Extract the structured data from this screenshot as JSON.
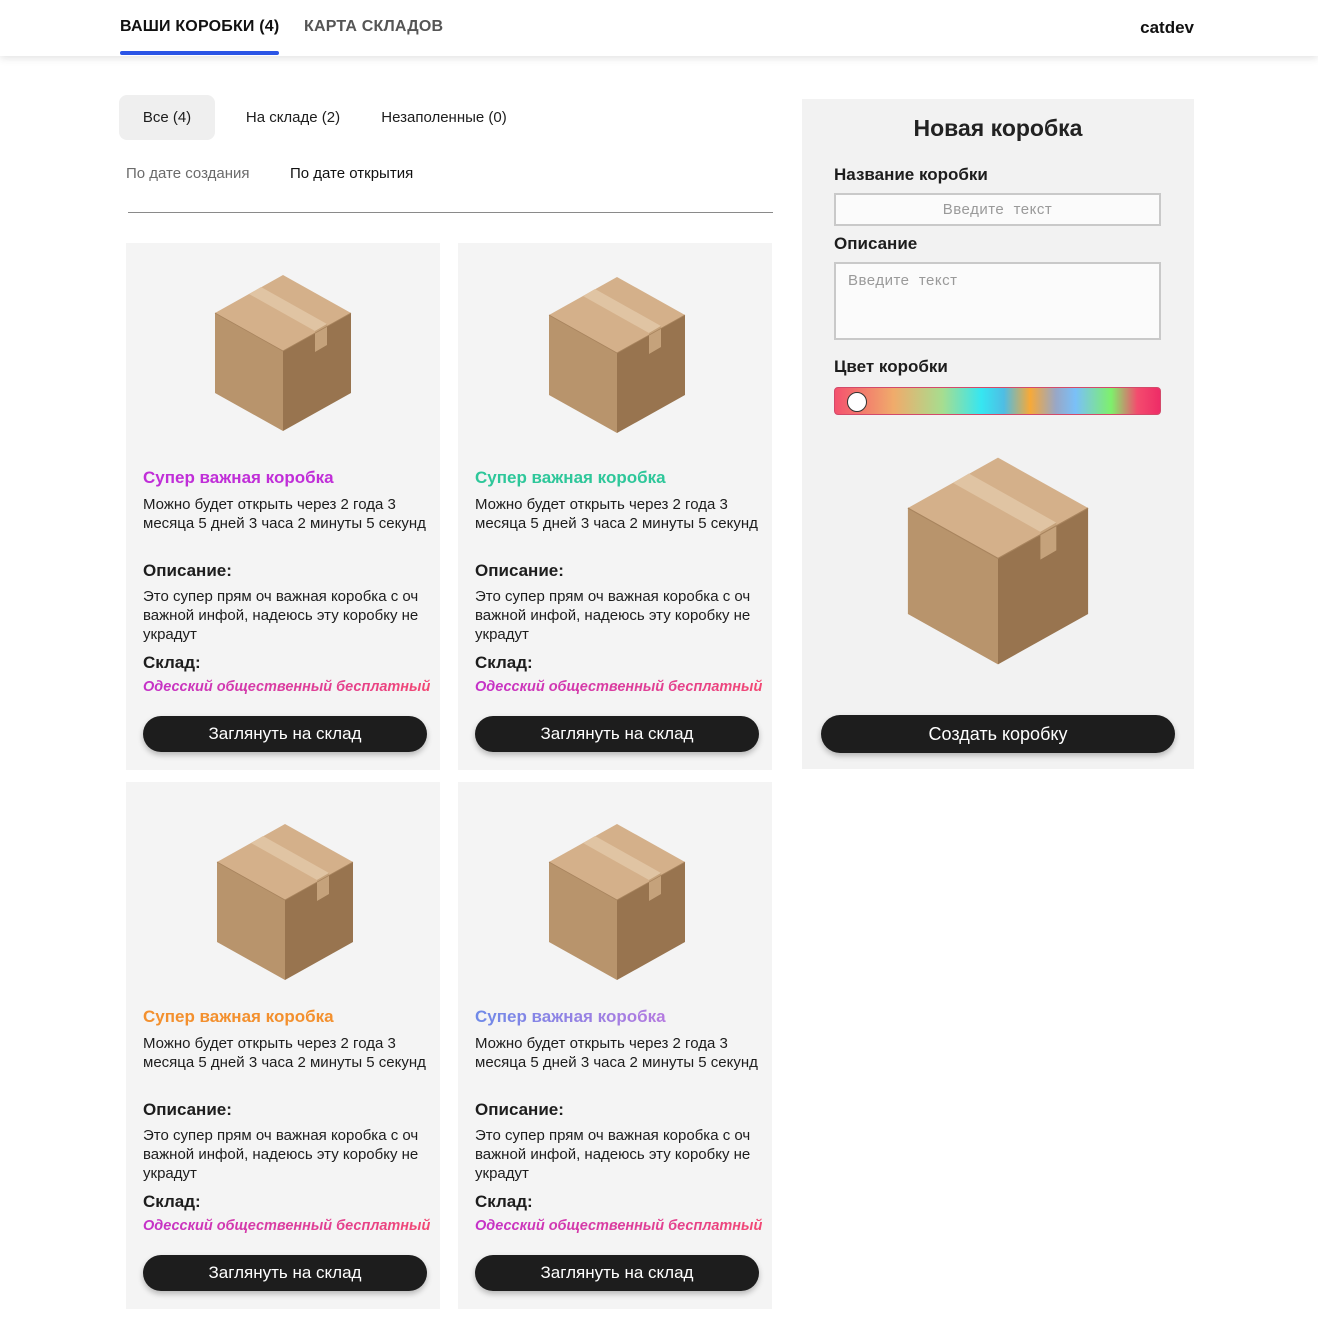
{
  "nav": {
    "tabs": [
      {
        "label": "ВАШИ КОРОБКИ (4)",
        "active": true
      },
      {
        "label": "КАРТА СКЛАДОВ",
        "active": false
      }
    ],
    "user": "catdev"
  },
  "filters": [
    {
      "label": "Все (4)",
      "active": true
    },
    {
      "label": "На складе (2)",
      "active": false
    },
    {
      "label": "Незаполенные (0)",
      "active": false
    }
  ],
  "sort": [
    {
      "label": "По дате создания",
      "active": false
    },
    {
      "label": "По дате открытия",
      "active": true
    }
  ],
  "cards": [
    {
      "title": "Супер важная коробка",
      "title_color": "#c02ed8",
      "open_text": "Можно будет открыть через 2 года 3 месяца 5 дней 3 часа 2 минуты 5 секунд",
      "desc_label": "Описание:",
      "desc_text": "Это супер прям оч важная коробка с оч важной инфой, надеюсь эту коробку не украдут",
      "wh_label": "Склад:",
      "warehouse": "Одесский общественный бесплатный",
      "button": "Заглянуть на склад"
    },
    {
      "title": "Супер важная коробка",
      "title_color": "#2ec79a",
      "open_text": "Можно будет открыть через 2 года 3 месяца 5 дней 3 часа 2 минуты 5 секунд",
      "desc_label": "Описание:",
      "desc_text": "Это супер прям оч важная коробка с оч важной инфой, надеюсь эту коробку не украдут",
      "wh_label": "Склад:",
      "warehouse": "Одесский общественный бесплатный",
      "button": "Заглянуть на склад"
    },
    {
      "title": "Супер важная коробка",
      "title_color": "#f3902e",
      "open_text": "Можно будет открыть через 2 года 3 месяца 5 дней 3 часа 2 минуты 5 секунд",
      "desc_label": "Описание:",
      "desc_text": "Это супер прям оч важная коробка с оч важной инфой, надеюсь эту коробку не украдут",
      "wh_label": "Склад:",
      "warehouse": "Одесский общественный бесплатный",
      "button": "Заглянуть на склад"
    },
    {
      "title": "Супер важная коробка",
      "title_color": "#8a7ee6",
      "open_text": "Можно будет открыть через 2 года 3 месяца 5 дней 3 часа 2 минуты 5 секунд",
      "desc_label": "Описание:",
      "desc_text": "Это супер прям оч важная коробка с оч важной инфой, надеюсь эту коробку не украдут",
      "wh_label": "Склад:",
      "warehouse": "Одесский общественный бесплатный",
      "button": "Заглянуть на склад"
    }
  ],
  "new_box": {
    "title": "Новая коробка",
    "name_label": "Название коробки",
    "name_placeholder": "Введите  текст",
    "desc_label": "Описание",
    "desc_placeholder": "Введите  текст",
    "color_label": "Цвет коробки",
    "create_button": "Создать коробку"
  },
  "colors": {
    "nav_underline": "#2b55e6",
    "button_bg": "#1d1d1d",
    "card_bg": "#f4f4f4",
    "warehouse_gradient": [
      "#c431c9",
      "#f24873"
    ]
  }
}
